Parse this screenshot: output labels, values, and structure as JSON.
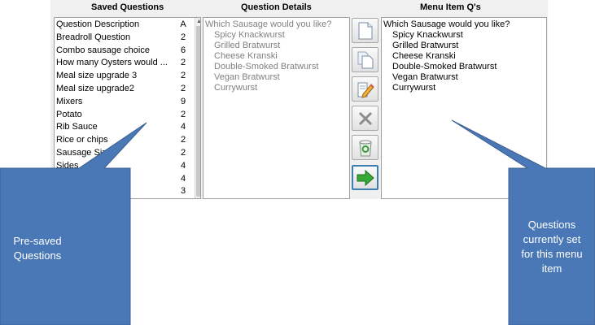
{
  "headers": {
    "saved": "Saved Questions",
    "details": "Question Details",
    "menu": "Menu Item Q's"
  },
  "saved_list": {
    "rows": [
      {
        "name": "Question Description",
        "count": "A"
      },
      {
        "name": "Breadroll Question",
        "count": "2"
      },
      {
        "name": "Combo sausage choice",
        "count": "6"
      },
      {
        "name": "How many Oysters would ...",
        "count": "2"
      },
      {
        "name": "Meal size upgrade 3",
        "count": "2"
      },
      {
        "name": "Meal size upgrade2",
        "count": "2"
      },
      {
        "name": "Mixers",
        "count": "9"
      },
      {
        "name": "Potato",
        "count": "2"
      },
      {
        "name": "Rib Sauce",
        "count": "4"
      },
      {
        "name": "Rice or chips",
        "count": "2"
      },
      {
        "name": "Sausage Size",
        "count": "2"
      },
      {
        "name": "Sides",
        "count": "4"
      },
      {
        "name": "",
        "count": "4"
      },
      {
        "name": "",
        "count": "3"
      }
    ]
  },
  "details": {
    "question": "Which Sausage would you like?",
    "options": [
      "Spicy Knackwurst",
      "Grilled Bratwurst",
      "Cheese Kranski",
      "Double-Smoked Bratwurst",
      "Vegan Bratwurst",
      "Currywurst"
    ]
  },
  "menu_item": {
    "question": "Which Sausage would you like?",
    "options": [
      "Spicy Knackwurst",
      "Grilled Bratwurst",
      "Cheese Kranski",
      "Double-Smoked Bratwurst",
      "Vegan Bratwurst",
      "Currywurst"
    ]
  },
  "toolbar": {
    "icons": [
      "new-document-icon",
      "copy-icon",
      "edit-icon",
      "delete-icon",
      "recycle-bin-icon",
      "arrow-right-icon"
    ]
  },
  "callouts": {
    "left": "Pre-saved Questions",
    "right": "Questions currently set for this menu item"
  },
  "colors": {
    "callout_fill": "#4a78b7",
    "callout_border": "#3a5f8f",
    "detail_text": "#808080",
    "button_border_active": "#3c7fb1"
  }
}
